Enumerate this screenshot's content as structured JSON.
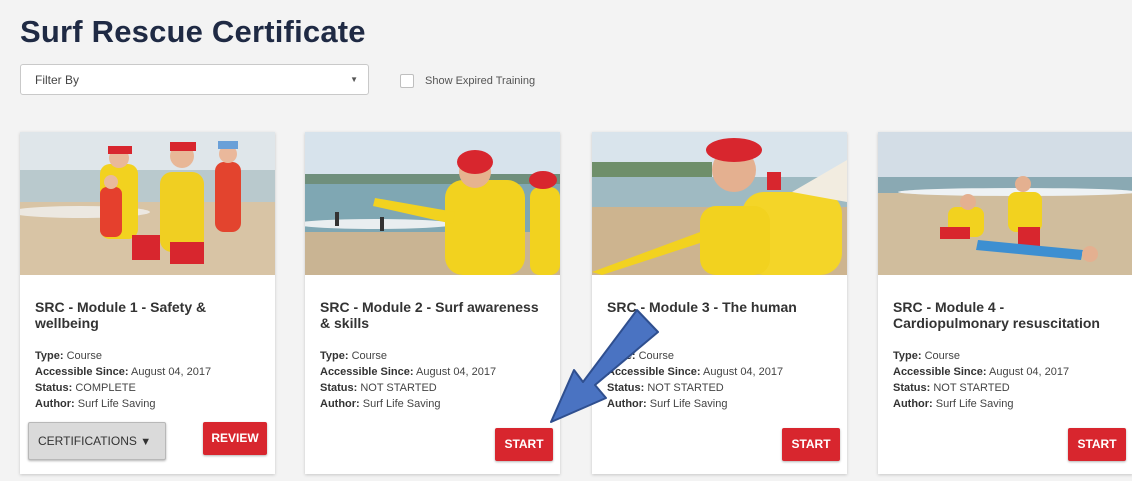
{
  "page": {
    "title": "Surf Rescue Certificate"
  },
  "filters": {
    "filter_by": "Filter By",
    "show_expired_label": "Show Expired Training",
    "show_expired_checked": false
  },
  "labels": {
    "type": "Type:",
    "accessible_since": "Accessible Since:",
    "status": "Status:",
    "author": "Author:"
  },
  "cards": [
    {
      "title": "SRC - Module 1 - Safety & wellbeing",
      "type": "Course",
      "accessible_since": "August 04, 2017",
      "status": "COMPLETE",
      "author": "Surf Life Saving",
      "action": "REVIEW",
      "secondary_action": "CERTIFICATIONS"
    },
    {
      "title": "SRC - Module 2 - Surf awareness & skills",
      "type": "Course",
      "accessible_since": "August 04, 2017",
      "status": "NOT STARTED",
      "author": "Surf Life Saving",
      "action": "START"
    },
    {
      "title": "SRC - Module 3 - The human",
      "type": "Course",
      "accessible_since": "August 04, 2017",
      "status": "NOT STARTED",
      "author": "Surf Life Saving",
      "action": "START"
    },
    {
      "title": "SRC - Module 4 - Cardiopulmonary resuscitation",
      "type": "Course",
      "accessible_since": "August 04, 2017",
      "status": "NOT STARTED",
      "author": "Surf Life Saving",
      "action": "START"
    }
  ],
  "colors": {
    "primary_red": "#d8262e",
    "title_navy": "#1f2a44",
    "annotation_arrow": "#4a73c2"
  },
  "icons": {
    "caret": "caret-down-icon",
    "annotation": "arrow-annotation-icon"
  }
}
